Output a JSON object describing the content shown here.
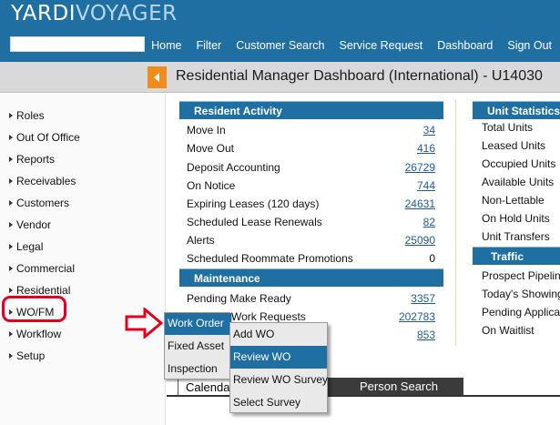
{
  "header": {
    "logo_part1": "YARDI",
    "logo_part2": "VOYAGER",
    "search_value": "",
    "nav": [
      "Home",
      "Filter",
      "Customer Search",
      "Service Request",
      "Dashboard",
      "Sign Out"
    ]
  },
  "title_bar": {
    "title": "Residential Manager Dashboard (International) - U14030"
  },
  "sidebar": {
    "items": [
      "Roles",
      "Out Of Office",
      "Reports",
      "Receivables",
      "Customers",
      "Vendor",
      "Legal",
      "Commercial",
      "Residential",
      "WO/FM",
      "Workflow",
      "Setup"
    ]
  },
  "resident_activity": {
    "title": "Resident Activity",
    "rows": [
      {
        "label": "Move In",
        "value": "34"
      },
      {
        "label": "Move Out",
        "value": "416"
      },
      {
        "label": "Deposit Accounting",
        "value": "26729"
      },
      {
        "label": "On Notice",
        "value": "744"
      },
      {
        "label": "Expiring Leases (120 days)",
        "value": "24631"
      },
      {
        "label": "Scheduled Lease Renewals",
        "value": "82"
      },
      {
        "label": "Alerts",
        "value": "25090"
      },
      {
        "label": "Scheduled Roommate Promotions",
        "value": "0"
      }
    ]
  },
  "maintenance": {
    "title": "Maintenance",
    "rows": [
      {
        "label": "Pending Make Ready",
        "value": "3357"
      },
      {
        "label": "Work Requests",
        "value": "202783"
      },
      {
        "label": "",
        "value": "853"
      }
    ]
  },
  "unit_statistics": {
    "title": "Unit Statistics",
    "rows": [
      "Total Units",
      "Leased Units",
      "Occupied Units",
      "Available Units",
      "Non-Lettable",
      "On Hold Units",
      "Unit Transfers"
    ]
  },
  "traffic": {
    "title": "Traffic",
    "rows": [
      "Prospect Pipeline",
      "Today's Showings",
      "Pending Applications",
      "On Waitlist"
    ]
  },
  "tabs": {
    "calendar": "Calendar",
    "person_search": "Person Search"
  },
  "menu_wo": {
    "items": [
      "Work Order",
      "Fixed Asset",
      "Inspection"
    ],
    "active_index": 0
  },
  "menu_work_order": {
    "items": [
      "Add WO",
      "Review WO",
      "Review WO Survey",
      "Select Survey"
    ],
    "active_index": 1
  },
  "colors": {
    "header_blue": "#1f6fa3",
    "accent_orange": "#f08c1e",
    "highlight_red": "#e5001d",
    "link_blue": "#1f5aa0"
  }
}
